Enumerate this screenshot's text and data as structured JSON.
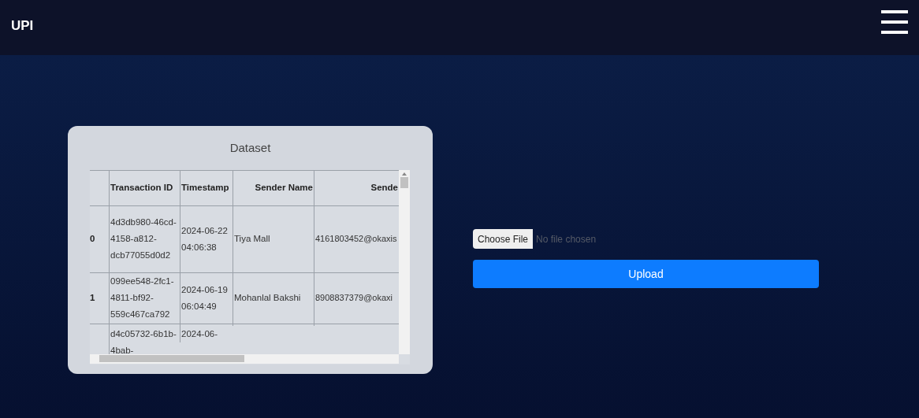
{
  "header": {
    "title": "UPI"
  },
  "dataset": {
    "title": "Dataset",
    "columns": [
      "Transaction ID",
      "Timestamp",
      "Sender Name",
      "Sende"
    ],
    "rows": [
      {
        "index": "0",
        "cells": [
          "4d3db980-46cd-4158-a812-dcb77055d0d2",
          "2024-06-22 04:06:38",
          "Tiya Mall",
          "4161803452@okaxis"
        ]
      },
      {
        "index": "1",
        "cells": [
          "099ee548-2fc1-4811-bf92-559c467ca792",
          "2024-06-19 06:04:49",
          "Mohanlal Bakshi",
          "8908837379@okaxi"
        ]
      },
      {
        "cells": [
          "d4c05732-6b1b-4bab-",
          "2024-06-"
        ]
      }
    ]
  },
  "upload": {
    "choose_button": "Choose File",
    "file_status": "No file chosen",
    "upload_button": "Upload"
  }
}
